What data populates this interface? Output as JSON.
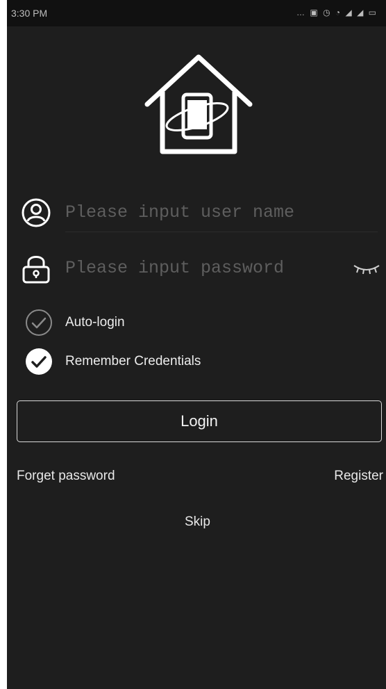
{
  "status_bar": {
    "time": "3:30 PM",
    "icons": [
      "more-icon",
      "sim-icon",
      "alarm-icon",
      "wifi-icon",
      "signal-icon",
      "signal-icon",
      "battery-icon"
    ]
  },
  "logo": {
    "icon": "house-phone-icon"
  },
  "username": {
    "placeholder": "Please input user name",
    "value": "",
    "icon": "user-icon"
  },
  "password": {
    "placeholder": "Please input password",
    "value": "",
    "icon": "lock-icon",
    "toggle_icon": "eye-closed-icon"
  },
  "options": {
    "auto_login": {
      "label": "Auto-login",
      "checked": false
    },
    "remember": {
      "label": "Remember Credentials",
      "checked": true
    }
  },
  "login_button": {
    "label": "Login"
  },
  "links": {
    "forget_password": "Forget password",
    "register": "Register",
    "skip": "Skip"
  },
  "colors": {
    "background": "#1e1e1e",
    "status_bar": "#111111",
    "text": "#ececec",
    "placeholder": "#5e5e5e",
    "border": "#d9d9d9"
  }
}
